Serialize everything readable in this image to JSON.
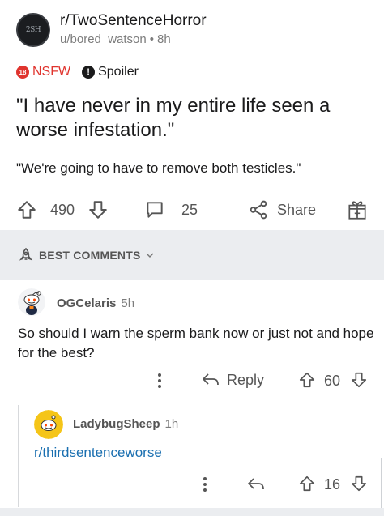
{
  "post": {
    "subreddit": "r/TwoSentenceHorror",
    "subreddit_avatar_text": "2SH",
    "author": "u/bored_watson",
    "age": "8h",
    "dot": "•",
    "nsfw_label": "NSFW",
    "nsfw_badge": "18",
    "spoiler_label": "Spoiler",
    "spoiler_badge": "!",
    "title": "\"I have never in my entire life seen a worse infestation.\"",
    "body": "\"We're going to have to remove both testicles.\"",
    "upvotes": "490",
    "comments": "25",
    "share_label": "Share"
  },
  "sort": {
    "label": "BEST COMMENTS"
  },
  "comments": [
    {
      "username": "OGCelaris",
      "age": "5h",
      "body": "So should I warn the sperm bank now or just not and hope for the best?",
      "reply_label": "Reply",
      "score": "60"
    },
    {
      "username": "LadybugSheep",
      "age": "1h",
      "body": "r/thirdsentenceworse",
      "score": "16"
    }
  ],
  "colors": {
    "nsfw": "#e0342e",
    "link": "#1a6fb0",
    "band": "#ebedf0",
    "icon": "#555555"
  }
}
